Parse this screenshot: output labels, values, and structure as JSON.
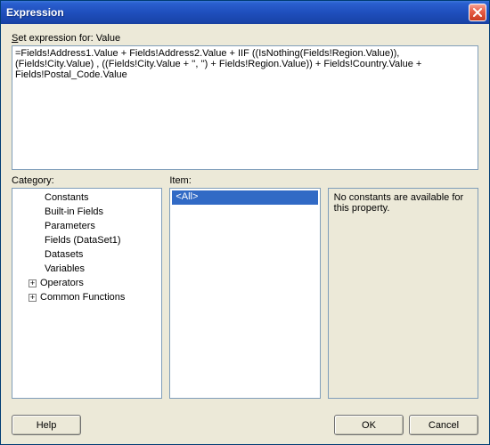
{
  "window": {
    "title": "Expression"
  },
  "labels": {
    "set_expression_prefix": "S",
    "set_expression_rest": "et expression for: Value",
    "category": "Category:",
    "item": "Item:"
  },
  "expression": {
    "value": "=Fields!Address1.Value + Fields!Address2.Value + IIF ((IsNothing(Fields!Region.Value)), (Fields!City.Value) , ((Fields!City.Value + '', '') + Fields!Region.Value)) + Fields!Country.Value + Fields!Postal_Code.Value"
  },
  "category_tree": [
    {
      "label": "Constants",
      "expandable": false,
      "selected": true
    },
    {
      "label": "Built-in Fields",
      "expandable": false
    },
    {
      "label": "Parameters",
      "expandable": false
    },
    {
      "label": "Fields (DataSet1)",
      "expandable": false
    },
    {
      "label": "Datasets",
      "expandable": false
    },
    {
      "label": "Variables",
      "expandable": false
    },
    {
      "label": "Operators",
      "expandable": true
    },
    {
      "label": "Common Functions",
      "expandable": true
    }
  ],
  "item_list": [
    {
      "label": "<All>",
      "selected": true
    }
  ],
  "description": "No constants are available for this property.",
  "buttons": {
    "help": "Help",
    "ok": "OK",
    "cancel": "Cancel"
  }
}
